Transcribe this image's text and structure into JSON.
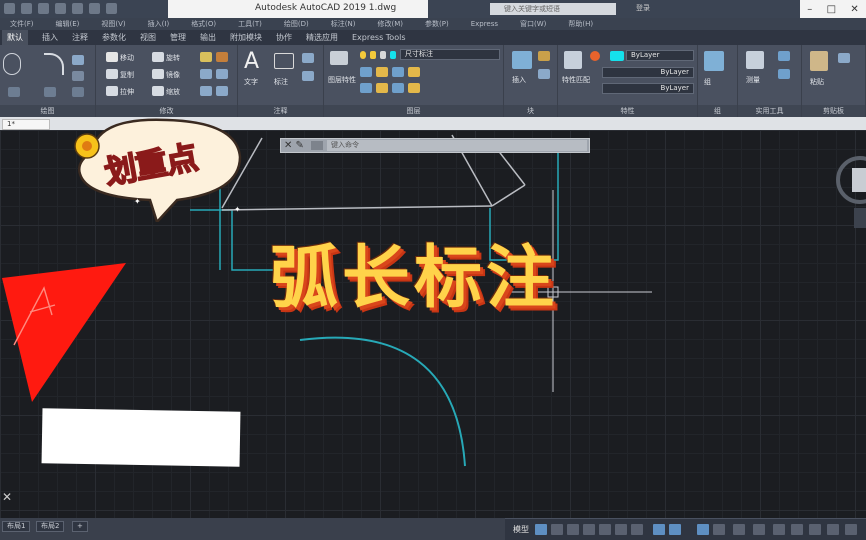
{
  "titlebar": {
    "app_title": "Autodesk AutoCAD 2019    1.dwg",
    "search_placeholder": "键入关键字或短语",
    "user": "登录"
  },
  "menubar": [
    "文件(F)",
    "编辑(E)",
    "视图(V)",
    "插入(I)",
    "格式(O)",
    "工具(T)",
    "绘图(D)",
    "标注(N)",
    "修改(M)",
    "参数(P)",
    "Express",
    "窗口(W)",
    "帮助(H)"
  ],
  "ribbon_tabs": [
    "默认",
    "插入",
    "注释",
    "参数化",
    "视图",
    "管理",
    "输出",
    "附加模块",
    "协作",
    "精选应用",
    "Express Tools"
  ],
  "ribbon": {
    "panels": [
      "绘图",
      "修改",
      "注释",
      "图层",
      "块",
      "特性",
      "组",
      "实用工具",
      "剪贴板"
    ],
    "modify_tools": [
      "移动",
      "旋转",
      "复制",
      "镜像",
      "拉伸",
      "缩放"
    ],
    "annotate_tools": [
      "文字",
      "标注"
    ],
    "layer_properties": "图层特性",
    "layer_dropdown": "尺寸标注",
    "insert": "插入",
    "match_props": "特性匹配",
    "bylayer": "ByLayer",
    "group": "组",
    "measure": "测量",
    "paste": "粘贴"
  },
  "drawing_tab": "1*",
  "command": {
    "placeholder": "键入命令"
  },
  "overlay": {
    "bubble_text": "划重点",
    "headline": "弧长标注"
  },
  "layout_tabs": [
    "布局1",
    "布局2",
    "+"
  ],
  "status": {
    "model": "模型"
  },
  "colors": {
    "headline": "#ffd34a",
    "headline_shadow": "#d9461b",
    "triangle": "#ff1a10",
    "cyan_lines": "#27a9b7"
  }
}
